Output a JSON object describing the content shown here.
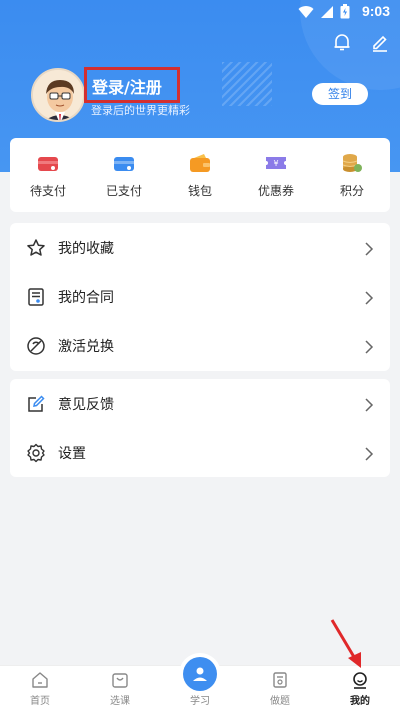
{
  "status": {
    "time": "9:03"
  },
  "profile": {
    "login_label": "登录/注册",
    "subtitle": "登录后的世界更精彩",
    "signin_label": "签到"
  },
  "quick": [
    {
      "label": "待支付",
      "icon": "pending-payment-icon",
      "color": "#e5484d"
    },
    {
      "label": "已支付",
      "icon": "paid-icon",
      "color": "#3b8cf0"
    },
    {
      "label": "钱包",
      "icon": "wallet-icon",
      "color": "#f59a23"
    },
    {
      "label": "优惠券",
      "icon": "coupon-icon",
      "color": "#8b7be8"
    },
    {
      "label": "积分",
      "icon": "points-icon",
      "color": "#e0a84a"
    }
  ],
  "menu1": [
    {
      "label": "我的收藏",
      "icon": "star-icon"
    },
    {
      "label": "我的合同",
      "icon": "contract-icon"
    },
    {
      "label": "激活兑换",
      "icon": "activate-icon"
    }
  ],
  "menu2": [
    {
      "label": "意见反馈",
      "icon": "feedback-icon"
    },
    {
      "label": "设置",
      "icon": "gear-icon"
    }
  ],
  "tabs": [
    {
      "label": "首页",
      "icon": "home-icon"
    },
    {
      "label": "选课",
      "icon": "course-bag-icon"
    },
    {
      "label": "学习",
      "icon": "study-icon"
    },
    {
      "label": "做题",
      "icon": "exercise-icon"
    },
    {
      "label": "我的",
      "icon": "profile-icon"
    }
  ]
}
